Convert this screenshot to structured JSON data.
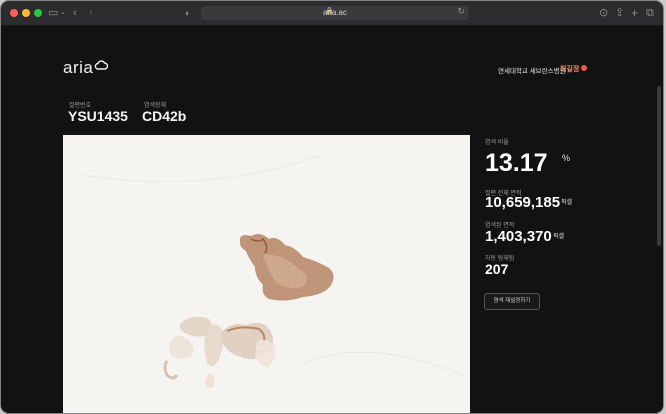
{
  "browser": {
    "url": "aria.ac"
  },
  "header": {
    "logo_text": "aria",
    "organization": "연세대학교 세브란스병원",
    "user_name": "허길정"
  },
  "meta": {
    "slide_label": "절편번호",
    "slide_id": "YSU1435",
    "marker_label": "염색항체",
    "marker": "CD42b"
  },
  "stats": {
    "ratio_label": "염색 비율",
    "ratio_value": "13.17",
    "ratio_unit": "%",
    "total_label": "절편 전체 면적",
    "total_value": "10,659,185",
    "total_unit": "픽셀",
    "stained_label": "염색된 면적",
    "stained_value": "1,403,370",
    "stained_unit": "픽셀",
    "count_label": "자동 탐재됨",
    "count_value": "207",
    "report_button": "염색 재설정하기"
  },
  "colors": {
    "background": "#121212",
    "stain": "#a0603a",
    "logout": "#e85a4f"
  }
}
